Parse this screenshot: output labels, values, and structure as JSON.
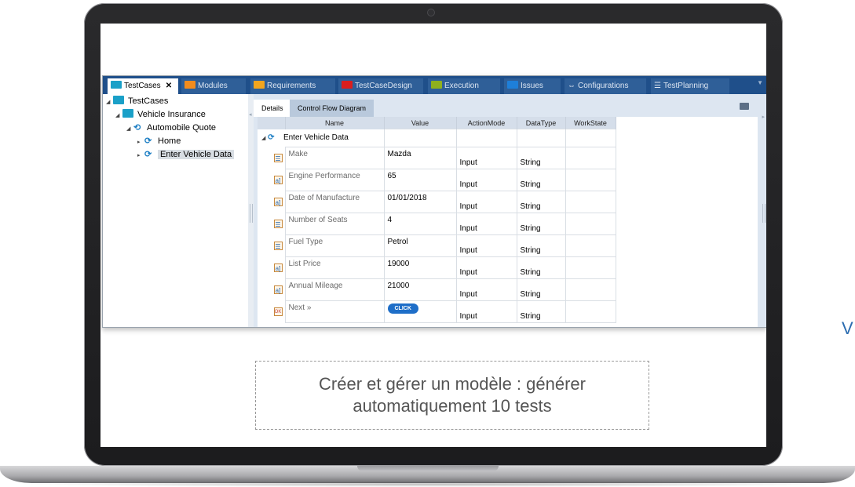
{
  "top_tabs": [
    {
      "label": "TestCases",
      "color": "#1aa0c8",
      "active": true,
      "closable": true
    },
    {
      "label": "Modules",
      "color": "#f28c1e"
    },
    {
      "label": "Requirements",
      "color": "#f2a51e"
    },
    {
      "label": "TestCaseDesign",
      "color": "#d91e1e"
    },
    {
      "label": "Execution",
      "color": "#8fb01e"
    },
    {
      "label": "Issues",
      "color": "#1e7fd9"
    },
    {
      "label": "Configurations",
      "icon": "link-icon"
    },
    {
      "label": "TestPlanning",
      "icon": "list-icon"
    }
  ],
  "tree": {
    "root": "TestCases",
    "folder": "Vehicle Insurance",
    "quote": "Automobile Quote",
    "home": "Home",
    "enter": "Enter Vehicle Data"
  },
  "detail": {
    "tab_details": "Details",
    "tab_flow": "Control Flow Diagram"
  },
  "grid": {
    "headers": [
      "Name",
      "Value",
      "ActionMode",
      "DataType",
      "WorkState"
    ],
    "group": "Enter Vehicle Data",
    "rows": [
      {
        "icon": "list-field-icon",
        "icon_glyph": "☰",
        "name": "Make",
        "value": "Mazda",
        "mode": "Input",
        "type": "String"
      },
      {
        "icon": "text-field-icon",
        "icon_glyph": "a]",
        "name": "Engine Performance",
        "value": "65",
        "mode": "Input",
        "type": "String"
      },
      {
        "icon": "text-field-icon",
        "icon_glyph": "a]",
        "name": "Date of Manufacture",
        "value": "01/01/2018",
        "mode": "Input",
        "type": "String"
      },
      {
        "icon": "list-field-icon",
        "icon_glyph": "☰",
        "name": "Number of Seats",
        "value": "4",
        "mode": "Input",
        "type": "String"
      },
      {
        "icon": "list-field-icon",
        "icon_glyph": "☰",
        "name": "Fuel Type",
        "value": "Petrol",
        "mode": "Input",
        "type": "String"
      },
      {
        "icon": "text-field-icon",
        "icon_glyph": "a]",
        "name": "List Price",
        "value": "19000",
        "mode": "Input",
        "type": "String"
      },
      {
        "icon": "text-field-icon",
        "icon_glyph": "a]",
        "name": "Annual Mileage",
        "value": "21000",
        "mode": "Input",
        "type": "String"
      },
      {
        "icon": "button-field-icon",
        "icon_glyph": "OK",
        "name": "Next »",
        "value_button": "CLICK",
        "mode": "Input",
        "type": "String"
      }
    ]
  },
  "caption_line1": "Créer et gérer un modèle : générer",
  "caption_line2": "automatiquement 10 tests",
  "side_text": "V"
}
